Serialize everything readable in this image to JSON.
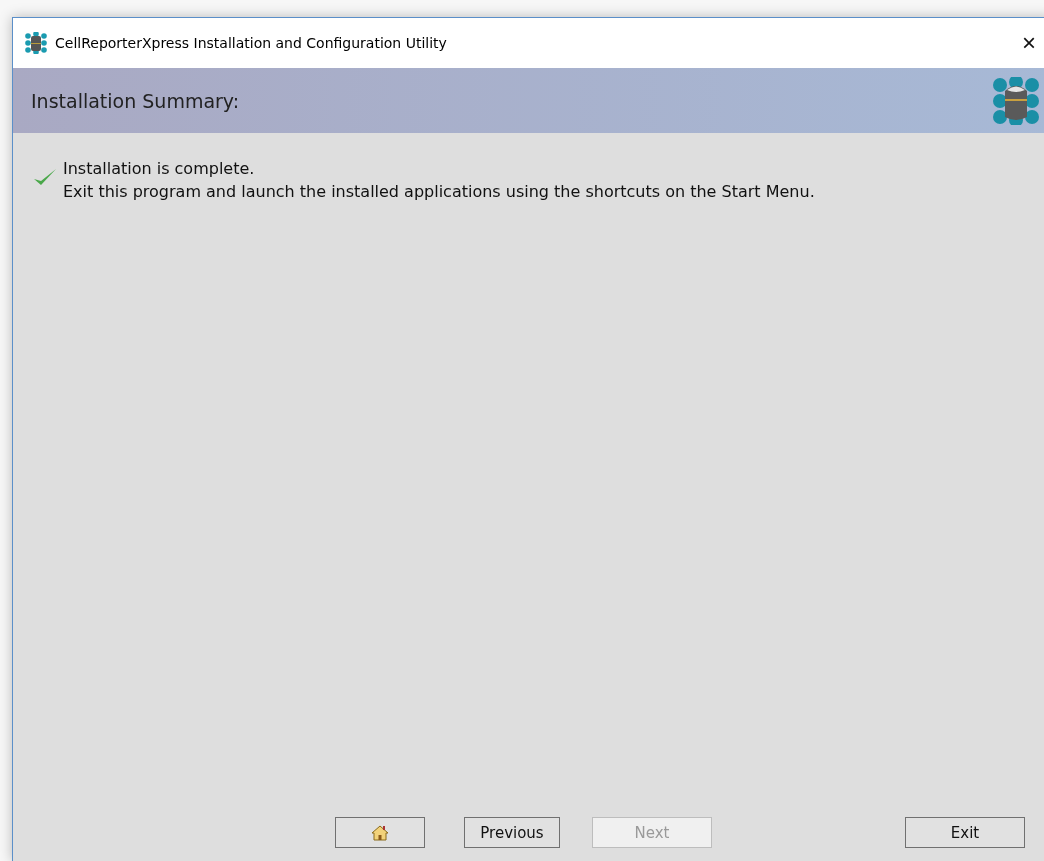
{
  "window": {
    "title": "CellReporterXpress Installation and Configuration Utility",
    "close": "×"
  },
  "header": {
    "title": "Installation Summary:"
  },
  "summary": {
    "complete": true,
    "lines": [
      "Installation is complete.",
      "Exit this program and launch the installed applications using the shortcuts on the Start Menu."
    ]
  },
  "buttons": [
    {
      "kind": "home",
      "disabled": false
    },
    {
      "kind": "text",
      "label": "Previous",
      "disabled": false
    },
    {
      "kind": "text",
      "label": "Next",
      "disabled": true
    },
    {
      "kind": "text",
      "label": "Exit",
      "disabled": false
    }
  ]
}
